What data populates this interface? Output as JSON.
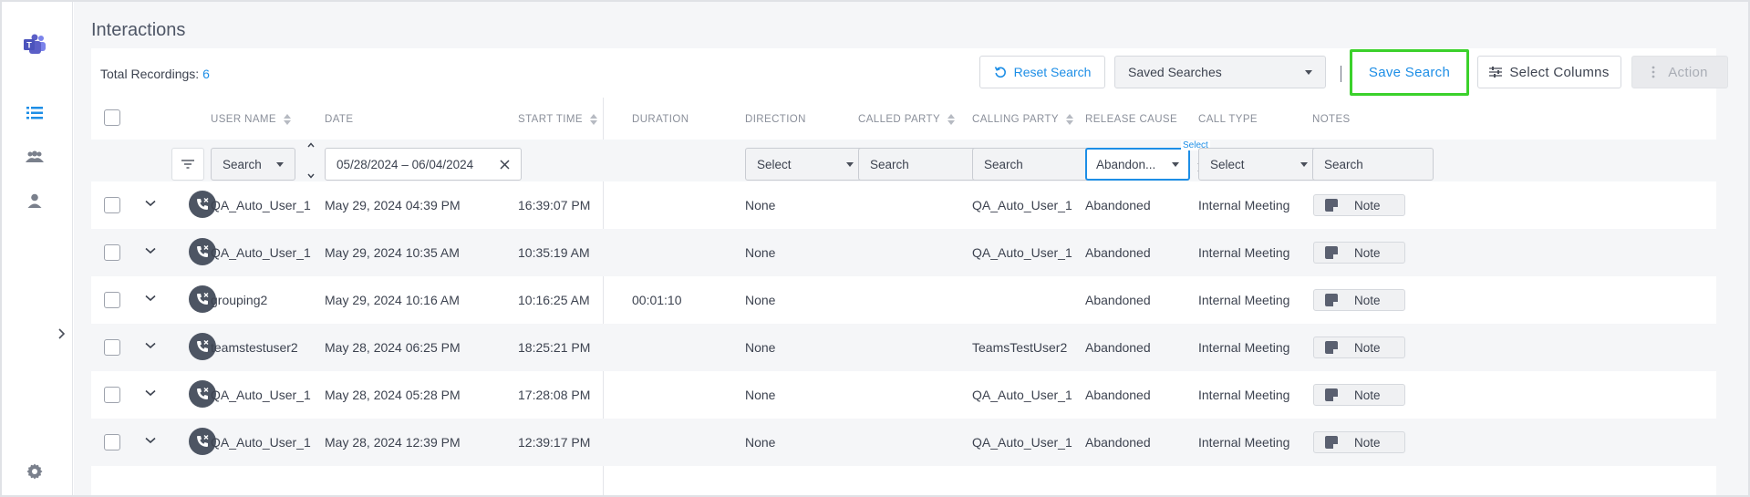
{
  "colors": {
    "accent": "#1d8ee6",
    "highlight": "#3bd12b",
    "brand": "#5b5fc7"
  },
  "page": {
    "title": "Interactions"
  },
  "toolbar": {
    "total_label": "Total Recordings:",
    "total_count": "6",
    "reset_label": "Reset Search",
    "saved_searches_label": "Saved Searches",
    "save_search_label": "Save Search",
    "select_columns_label": "Select Columns",
    "action_label": "Action"
  },
  "columns": {
    "user_name": "USER NAME",
    "date": "DATE",
    "start_time": "START TIME",
    "duration": "DURATION",
    "direction": "DIRECTION",
    "called_party": "CALLED PARTY",
    "calling_party": "CALLING PARTY",
    "release_cause": "RELEASE CAUSE",
    "call_type": "CALL TYPE",
    "notes": "NOTES"
  },
  "filters": {
    "user_name": "Search",
    "date_range": "05/28/2024 – 06/04/2024",
    "direction": "Select",
    "called_party": "Search",
    "calling_party": "Search",
    "release_cause_label": "Select",
    "release_cause_value": "Abandon...",
    "call_type": "Select",
    "notes": "Search"
  },
  "rows": [
    {
      "user": "QA_Auto_User_1",
      "date": "May 29, 2024 04:39 PM",
      "start": "16:39:07 PM",
      "duration": "",
      "direction": "None",
      "called": "",
      "calling": "QA_Auto_User_1",
      "cause": "Abandoned",
      "type": "Internal Meeting",
      "note": "Note"
    },
    {
      "user": "QA_Auto_User_1",
      "date": "May 29, 2024 10:35 AM",
      "start": "10:35:19 AM",
      "duration": "",
      "direction": "None",
      "called": "",
      "calling": "QA_Auto_User_1",
      "cause": "Abandoned",
      "type": "Internal Meeting",
      "note": "Note"
    },
    {
      "user": "grouping2",
      "date": "May 29, 2024 10:16 AM",
      "start": "10:16:25 AM",
      "duration": "00:01:10",
      "direction": "None",
      "called": "",
      "calling": "",
      "cause": "Abandoned",
      "type": "Internal Meeting",
      "note": "Note"
    },
    {
      "user": "teamstestuser2",
      "date": "May 28, 2024 06:25 PM",
      "start": "18:25:21 PM",
      "duration": "",
      "direction": "None",
      "called": "",
      "calling": "TeamsTestUser2",
      "cause": "Abandoned",
      "type": "Internal Meeting",
      "note": "Note"
    },
    {
      "user": "QA_Auto_User_1",
      "date": "May 28, 2024 05:28 PM",
      "start": "17:28:08 PM",
      "duration": "",
      "direction": "None",
      "called": "",
      "calling": "QA_Auto_User_1",
      "cause": "Abandoned",
      "type": "Internal Meeting",
      "note": "Note"
    },
    {
      "user": "QA_Auto_User_1",
      "date": "May 28, 2024 12:39 PM",
      "start": "12:39:17 PM",
      "duration": "",
      "direction": "None",
      "called": "",
      "calling": "QA_Auto_User_1",
      "cause": "Abandoned",
      "type": "Internal Meeting",
      "note": "Note"
    }
  ]
}
